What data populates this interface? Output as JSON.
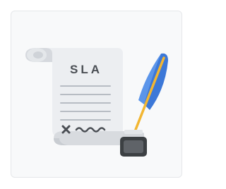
{
  "card": {
    "title_text": "SLA",
    "signature_mark": "×"
  },
  "icons": {
    "illustration": "sla-contract-scroll-with-quill",
    "quill": "blue-feather-quill-icon",
    "inkwell": "inkwell-icon"
  },
  "colors": {
    "card_background": "#f8f9fa",
    "paper": "#eceef1",
    "paper_shade": "#d6d9de",
    "ink_text": "#4a4e54",
    "feather_blue": "#3c78d8",
    "feather_blue_light": "#5b95ea",
    "quill_shaft": "#f2b632",
    "inkwell_body": "#3c4043",
    "inkwell_top": "#d5d8dc"
  }
}
